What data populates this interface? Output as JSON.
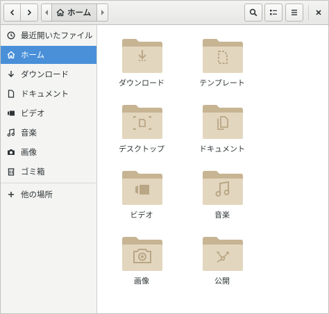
{
  "header": {
    "crumb": "ホーム",
    "icons": [
      "back-icon",
      "forward-icon",
      "home-icon",
      "search-icon",
      "view-list-icon",
      "menu-icon",
      "close-icon"
    ]
  },
  "sidebar": {
    "items": [
      {
        "label": "最近開いたファイル",
        "icon": "clock-icon",
        "active": false
      },
      {
        "label": "ホーム",
        "icon": "home-icon",
        "active": true
      },
      {
        "label": "ダウンロード",
        "icon": "download-icon",
        "active": false
      },
      {
        "label": "ドキュメント",
        "icon": "document-icon",
        "active": false
      },
      {
        "label": "ビデオ",
        "icon": "video-icon",
        "active": false
      },
      {
        "label": "音楽",
        "icon": "music-icon",
        "active": false
      },
      {
        "label": "画像",
        "icon": "camera-icon",
        "active": false
      },
      {
        "label": "ゴミ箱",
        "icon": "trash-icon",
        "active": false
      },
      {
        "label": "他の場所",
        "icon": "plus-icon",
        "active": false
      }
    ]
  },
  "folders": [
    {
      "label": "ダウンロード",
      "emblem": "download-emblem"
    },
    {
      "label": "テンプレート",
      "emblem": "template-emblem"
    },
    {
      "label": "デスクトップ",
      "emblem": "desktop-emblem"
    },
    {
      "label": "ドキュメント",
      "emblem": "documents-emblem"
    },
    {
      "label": "ビデオ",
      "emblem": "video-emblem"
    },
    {
      "label": "音楽",
      "emblem": "music-emblem"
    },
    {
      "label": "画像",
      "emblem": "camera-emblem"
    },
    {
      "label": "公開",
      "emblem": "share-emblem"
    }
  ],
  "colors": {
    "accent": "#4a90d9",
    "folder_back": "#c7b493",
    "folder_front": "#e3d6bf",
    "emblem": "#b9a684"
  }
}
